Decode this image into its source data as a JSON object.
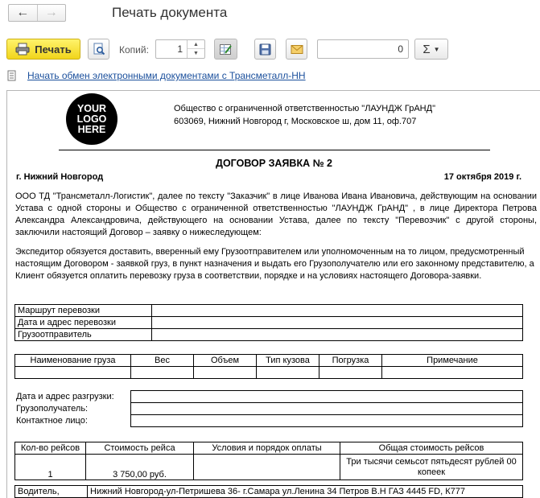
{
  "window": {
    "title": "Печать документа"
  },
  "toolbar": {
    "print_label": "Печать",
    "copies_label": "Копий:",
    "copies_value": "1",
    "sum_value": "0",
    "sum_symbol": "Σ"
  },
  "link": {
    "text": "Начать обмен электронными документами с Трансметалл-НН"
  },
  "document": {
    "logo": [
      "YOUR",
      "LOGO",
      "HERE"
    ],
    "org_name": "Общество с ограниченной ответственностью \"ЛАУНДЖ ГрАНД\"",
    "org_address": "603069, Нижний Новгород г, Московское ш, дом 11, оф.707",
    "title": "ДОГОВОР ЗАЯВКА № 2",
    "city": "г. Нижний Новгород",
    "date": "17 октября 2019 г.",
    "para1": "ООО ТД \"Трансметалл-Логистик\", далее по тексту \"Заказчик\"  в лице  Иванова Ивана Ивановича, действующим на основании Устава  с одной стороны и Общество с ограниченной ответственностью \"ЛАУНДЖ ГрАНД\" , в лице Директора Петрова Александра Александровича, действующего на основании Устава, далее по тексту \"Перевозчик\" с другой стороны, заключили настоящий Договор – заявку о нижеследующем:",
    "para2": "Экспедитор обязуется доставить, вверенный ему Грузоотправителем или уполномоченным на то лицом, предусмотренный настоящим Договором - заявкой груз, в пункт назначения и выдать его Грузополучателю или его законному представителю, а Клиент обязуется оплатить перевозку груза в соответствии, порядке и на условиях настоящего Договора-заявки.",
    "route_rows": [
      "Маршрут перевозки",
      "Дата и адрес перевозки",
      "Грузоотправитель"
    ],
    "cargo_headers": [
      "Наименование груза",
      "Вес",
      "Объем",
      "Тип кузова",
      "Погрузка",
      "Примечание"
    ],
    "unload_rows": [
      "Дата и адрес разгрузки:",
      "Грузополучатель:",
      "Контактное лицо:"
    ],
    "trip_headers": [
      "Кол-во рейсов",
      "Стоимость рейса",
      "Условия и порядок оплаты",
      "Общая стоимость рейсов"
    ],
    "trip_values": {
      "count": "1",
      "price": "3 750,00 руб.",
      "terms": "",
      "total": "Три тысячи семьсот пятьдесят рублей 00 копеек"
    },
    "driver_label": "Водитель,",
    "driver_value": "Нижний Новгород-ул-Петришева 36- г.Самара ул.Ленина 34 Петров  В.Н ГАЗ 4445 FD, К777"
  }
}
